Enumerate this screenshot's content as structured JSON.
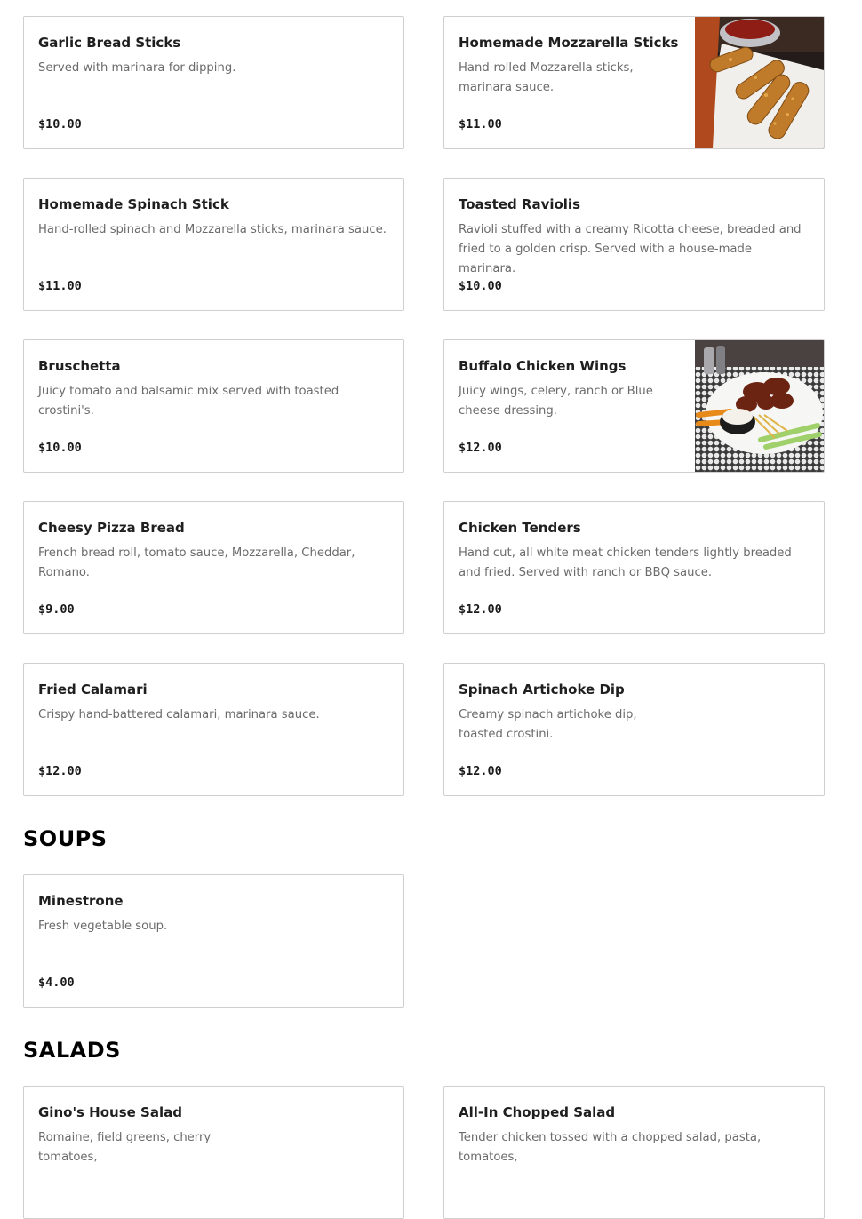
{
  "appetizers": {
    "items": [
      {
        "name": "Garlic Bread Sticks",
        "desc": "Served with marinara for dipping.",
        "price": "$10.00"
      },
      {
        "name": "Homemade Mozzarella Sticks",
        "desc": "Hand-rolled Mozzarella sticks, marinara sauce.",
        "price": "$11.00"
      },
      {
        "name": "Homemade Spinach Stick",
        "desc": "Hand-rolled spinach and Mozzarella sticks, marinara sauce.",
        "price": "$11.00"
      },
      {
        "name": "Toasted Raviolis",
        "desc": "Ravioli stuffed with a creamy Ricotta cheese, breaded and fried to a golden crisp. Served with a house-made marinara.",
        "price": "$10.00"
      },
      {
        "name": "Bruschetta",
        "desc": "Juicy tomato and balsamic mix served with toasted crostini's.",
        "price": "$10.00"
      },
      {
        "name": "Buffalo Chicken Wings",
        "desc": "Juicy wings, celery, ranch or Blue cheese dressing.",
        "price": "$12.00"
      },
      {
        "name": "Cheesy Pizza Bread",
        "desc": "French bread roll, tomato sauce, Mozzarella, Cheddar, Romano.",
        "price": "$9.00"
      },
      {
        "name": "Chicken Tenders",
        "desc": "Hand cut, all white meat chicken tenders lightly breaded and fried. Served with ranch or BBQ sauce.",
        "price": "$12.00"
      },
      {
        "name": "Fried Calamari",
        "desc": "Crispy hand-battered calamari, marinara sauce.",
        "price": "$12.00"
      },
      {
        "name": "Spinach Artichoke Dip",
        "desc": "Creamy spinach artichoke dip, toasted crostini.",
        "price": "$12.00"
      }
    ]
  },
  "soups": {
    "title": "SOUPS",
    "items": [
      {
        "name": "Minestrone",
        "desc": "Fresh vegetable soup.",
        "price": "$4.00"
      }
    ]
  },
  "salads": {
    "title": "SALADS",
    "items": [
      {
        "name": "Gino's House Salad",
        "desc": "Romaine, field greens, cherry tomatoes,"
      },
      {
        "name": "All-In Chopped Salad",
        "desc": "Tender chicken tossed with a chopped salad, pasta, tomatoes,"
      }
    ]
  }
}
